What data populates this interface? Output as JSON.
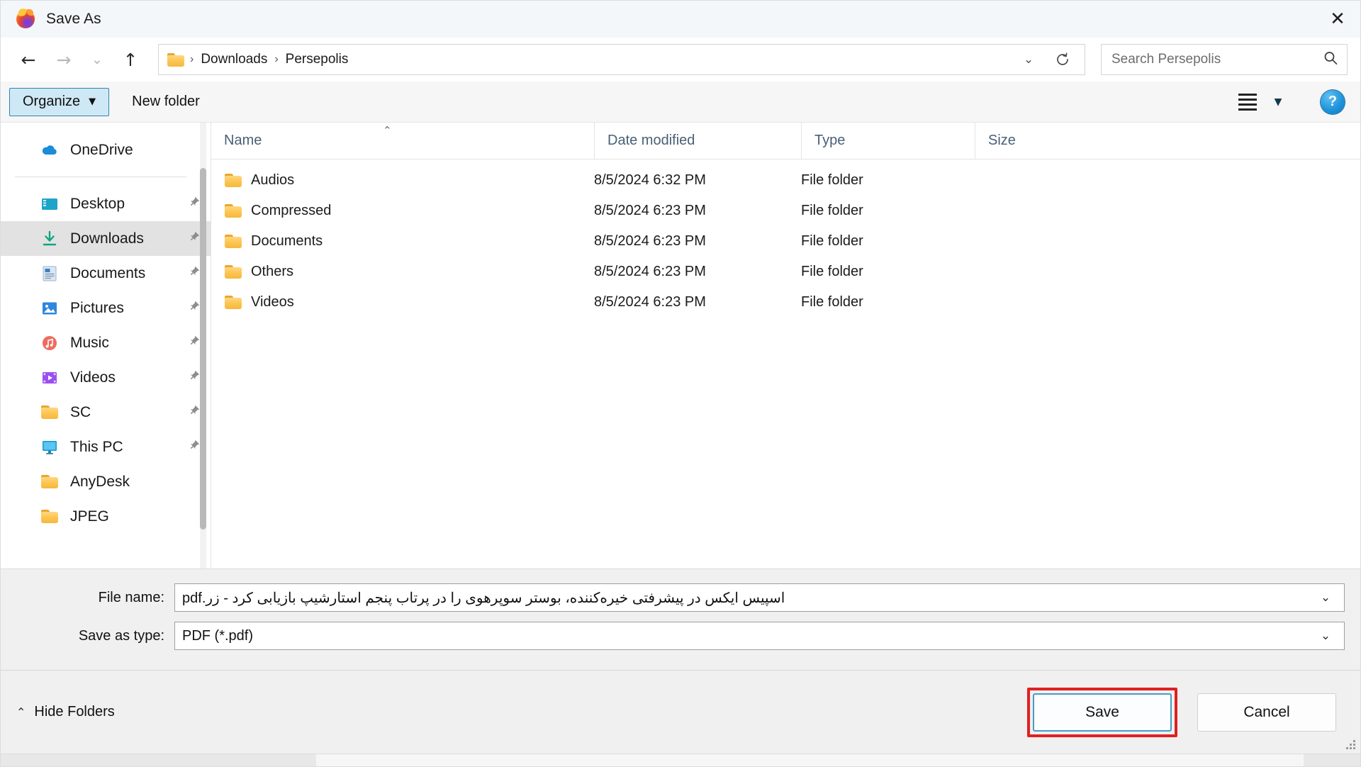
{
  "window": {
    "title": "Save As",
    "app_icon": "firefox-icon",
    "close_label": "✕"
  },
  "nav": {
    "back_label": "←",
    "forward_label": "→",
    "recent_label": "⌄",
    "up_label": "↑",
    "breadcrumb": [
      "Downloads",
      "Persepolis"
    ],
    "breadcrumb_separator": "›",
    "address_dropdown": "⌄",
    "refresh_label": "⟳"
  },
  "search": {
    "placeholder": "Search Persepolis",
    "value": "",
    "icon": "search-icon"
  },
  "toolbar": {
    "organize_label": "Organize",
    "organize_caret": "▼",
    "new_folder_label": "New folder",
    "view_icon": "list-view-icon",
    "view_caret": "▼",
    "help_label": "?"
  },
  "sidebar": {
    "groups": [
      {
        "items": [
          {
            "label": "OneDrive",
            "icon": "cloud-icon",
            "pinned": false,
            "selected": false
          }
        ]
      },
      {
        "items": [
          {
            "label": "Desktop",
            "icon": "desktop-icon",
            "pinned": true,
            "selected": false
          },
          {
            "label": "Downloads",
            "icon": "downloads-icon",
            "pinned": true,
            "selected": true
          },
          {
            "label": "Documents",
            "icon": "documents-icon",
            "pinned": true,
            "selected": false
          },
          {
            "label": "Pictures",
            "icon": "pictures-icon",
            "pinned": true,
            "selected": false
          },
          {
            "label": "Music",
            "icon": "music-icon",
            "pinned": true,
            "selected": false
          },
          {
            "label": "Videos",
            "icon": "videos-icon",
            "pinned": true,
            "selected": false
          },
          {
            "label": "SC",
            "icon": "folder-icon",
            "pinned": true,
            "selected": false
          },
          {
            "label": "This PC",
            "icon": "this-pc-icon",
            "pinned": true,
            "selected": false
          },
          {
            "label": "AnyDesk",
            "icon": "folder-icon",
            "pinned": false,
            "selected": false
          },
          {
            "label": "JPEG",
            "icon": "folder-icon",
            "pinned": false,
            "selected": false
          }
        ]
      }
    ],
    "pin_glyph": "📌"
  },
  "filelist": {
    "columns": [
      "Name",
      "Date modified",
      "Type",
      "Size"
    ],
    "sort_caret": "⌃",
    "rows": [
      {
        "name": "Audios",
        "date": "8/5/2024 6:32 PM",
        "type": "File folder",
        "size": ""
      },
      {
        "name": "Compressed",
        "date": "8/5/2024 6:23 PM",
        "type": "File folder",
        "size": ""
      },
      {
        "name": "Documents",
        "date": "8/5/2024 6:23 PM",
        "type": "File folder",
        "size": ""
      },
      {
        "name": "Others",
        "date": "8/5/2024 6:23 PM",
        "type": "File folder",
        "size": ""
      },
      {
        "name": "Videos",
        "date": "8/5/2024 6:23 PM",
        "type": "File folder",
        "size": ""
      }
    ]
  },
  "form": {
    "filename_label": "File name:",
    "filename_value": "اسپیس ایکس در پیشرفتی خیره‌کننده، بوستر سوپرهوی را در پرتاب پنجم استارشیپ بازیابی کرد - زر.pdf",
    "filetype_label": "Save as type:",
    "filetype_value": "PDF (*.pdf)",
    "dropdown_glyph": "⌄"
  },
  "footer": {
    "hide_folders_label": "Hide Folders",
    "hide_folders_caret": "⌃",
    "save_label": "Save",
    "cancel_label": "Cancel",
    "highlight_color": "#e02020",
    "focus_color": "#4a9ac4"
  }
}
